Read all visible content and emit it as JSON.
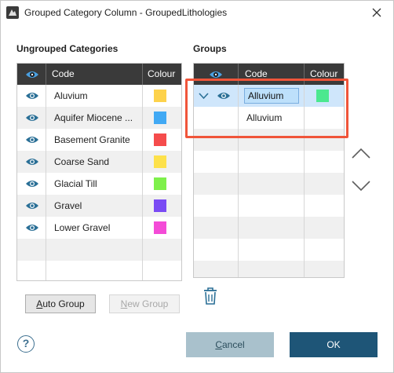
{
  "window": {
    "title": "Grouped Category Column - GroupedLithologies"
  },
  "ungrouped": {
    "label": "Ungrouped Categories",
    "headers": {
      "code": "Code",
      "colour": "Colour"
    },
    "rows": [
      {
        "code": "Aluvium",
        "colour": "#fdd24b"
      },
      {
        "code": "Aquifer Miocene ...",
        "colour": "#41a9f4"
      },
      {
        "code": "Basement Granite",
        "colour": "#f54c4c"
      },
      {
        "code": "Coarse Sand",
        "colour": "#fde14b"
      },
      {
        "code": "Glacial Till",
        "colour": "#7ef04b"
      },
      {
        "code": "Gravel",
        "colour": "#7a4bf4"
      },
      {
        "code": "Lower Gravel",
        "colour": "#f44bd7"
      }
    ]
  },
  "groups": {
    "label": "Groups",
    "headers": {
      "code": "Code",
      "colour": "Colour"
    },
    "group_row": {
      "code": "Alluvium",
      "colour": "#4be88f"
    },
    "child_row": {
      "code": "Alluvium"
    }
  },
  "buttons": {
    "auto_group": "Auto Group",
    "new_group": "New Group",
    "cancel": "Cancel",
    "ok": "OK",
    "help": "?"
  },
  "colors": {
    "highlight": "#f0553a",
    "header_bg": "#3a3a3a",
    "selected_row": "#cfe6fb"
  }
}
